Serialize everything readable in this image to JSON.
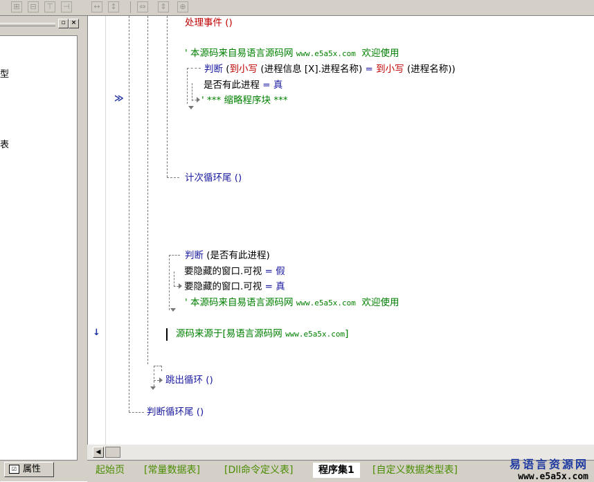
{
  "toolbar": {
    "icons": [
      "align-left-icon",
      "align-center-icon",
      "align-top-icon",
      "align-middle-icon",
      "space-horizontal-icon",
      "space-vertical-icon",
      "same-width-icon",
      "same-height-icon",
      "same-size-icon"
    ]
  },
  "left_panel": {
    "pin_label": "▫",
    "close_label": "×",
    "list_fragments": [
      "型",
      "表"
    ],
    "properties_tab": "属性"
  },
  "editor": {
    "gutter_marks": {
      "jump": "≫",
      "cursor": "↓"
    },
    "lines": {
      "l1": "处理事件 ()",
      "l2_prefix": "' 本源码来自易语言源码网 ",
      "l2_url": "www.e5a5x.com",
      "l2_suffix": "  欢迎使用",
      "l3_kw": "判断",
      "l3_a": " (",
      "l3_fn1": "到小写",
      "l3_b": " (进程信息 [X].进程名称) ",
      "l3_eq": "=",
      "l3_c": " ",
      "l3_fn2": "到小写",
      "l3_d": " (进程名称))",
      "l4_var": "是否有此进程",
      "l4_eq": " = ",
      "l4_val": "真",
      "l5": "' *** 缩略程序块 ***",
      "l6": "计次循环尾 ()",
      "l7_kw": "判断",
      "l7_rest": " (是否有此进程)",
      "l8_var": "要隐藏的窗口.可视",
      "l8_eq": " = ",
      "l8_val": "假",
      "l9_var": "要隐藏的窗口.可视",
      "l9_eq": " = ",
      "l9_val": "真",
      "l10_prefix": "' 本源码来自易语言源码网 ",
      "l10_url": "www.e5a5x.com",
      "l10_suffix": "  欢迎使用",
      "l11_prefix": "源码来源于[易语言源码网 ",
      "l11_url": "www.e5a5x.com",
      "l11_suffix": "]",
      "l12": "跳出循环 ()",
      "l13": "判断循环尾 ()"
    }
  },
  "scrollbar": {
    "left_arrow": "◀"
  },
  "tabs": [
    "起始页",
    "[常量数据表]",
    "[Dll命令定义表]",
    "程序集1",
    "[自定义数据类型表]"
  ],
  "active_tab": "程序集1",
  "watermark": {
    "line1": "易语言资源网",
    "line2": "www.e5a5x.com"
  }
}
